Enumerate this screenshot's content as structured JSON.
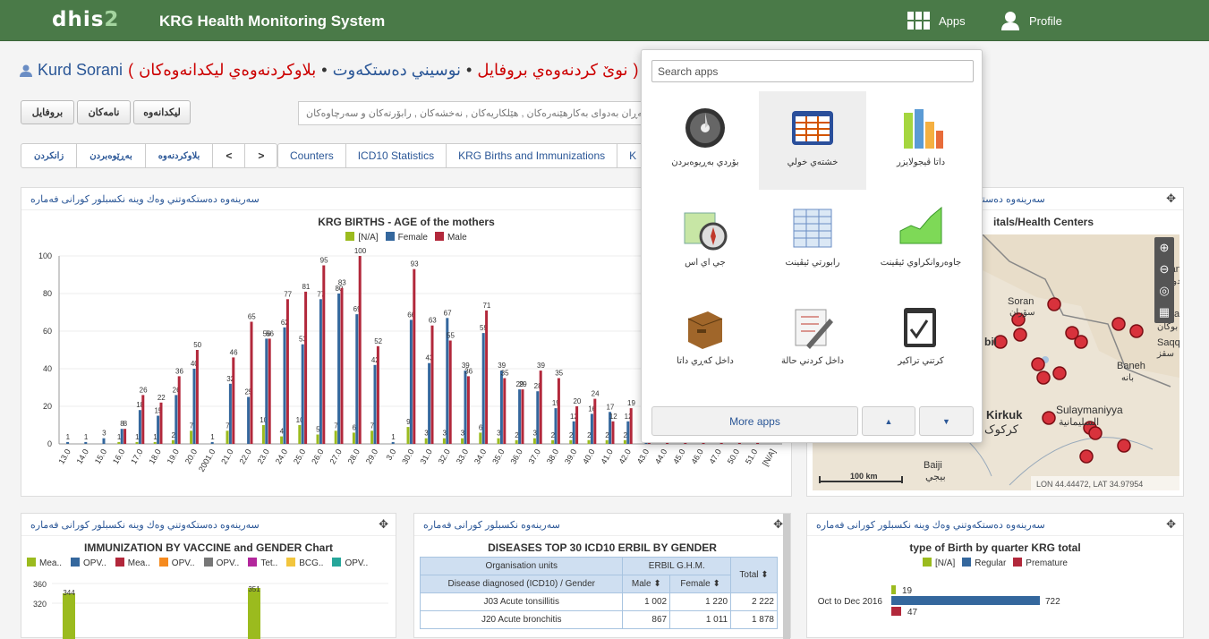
{
  "header": {
    "logo_main": "dhis",
    "logo_num": "2",
    "title": "KRG Health Monitoring System",
    "apps_label": "Apps",
    "profile_label": "Profile"
  },
  "user": {
    "name": "Kurd Sorani",
    "paren_open": "(",
    "new_interp": "نوێ كردنەوەي بروفايل",
    "sep1": "•",
    "write_post": "نوسيني دەستكەوت",
    "sep2": "•",
    "latest": "بلاوكردنەوەي ليكدانەوەكان",
    "paren_close": ")"
  },
  "buttons": {
    "interpretations": "ليكدانەوە",
    "messages": "نامەكان",
    "profile": "بروفايل"
  },
  "search_placeholder": "گەڕان بەدواى بەكارهێنەرەكان , هێلكاريەكان , نەخشەكان , رابۆرتەكان و سەرچاوەكان",
  "dash_tabs1": [
    "زانكردن",
    "بەڕێوەبردن",
    "بلاوكردنەوە",
    "<",
    ">"
  ],
  "dash_tabs2": [
    "Counters",
    "ICD10 Statistics",
    "KRG Births and Immunizations",
    "K"
  ],
  "panel_header": "سەرينەوە دەستكەوتني وەك وينە نكسبلور كورانى فەمارە",
  "panel_header2": "سەرينەوە دەستكەوتني وەك وينە نكسبلور كورانى فەمارە",
  "panel_header_tbl": "سەرينەوە نكسبلور كورانى فەمارە",
  "move_icon": "✥",
  "births": {
    "title": "KRG BIRTHS - AGE of the mothers",
    "legend": [
      "[N/A]",
      "Female",
      "Male"
    ]
  },
  "chart_data": [
    {
      "type": "bar",
      "title": "KRG BIRTHS - AGE of the mothers",
      "categories": [
        "13.0",
        "14.0",
        "15.0",
        "16.0",
        "17.0",
        "18.0",
        "19.0",
        "20.0",
        "2001.0",
        "21.0",
        "22.0",
        "23.0",
        "24.0",
        "25.0",
        "26.0",
        "27.0",
        "28.0",
        "29.0",
        "3.0",
        "30.0",
        "31.0",
        "32.0",
        "33.0",
        "34.0",
        "35.0",
        "36.0",
        "37.0",
        "38.0",
        "39.0",
        "40.0",
        "41.0",
        "42.0",
        "43.0",
        "44.0",
        "45.0",
        "46.0",
        "47.0",
        "50.0",
        "51.0",
        "[N/A]"
      ],
      "series": [
        {
          "name": "[N/A]",
          "color": "#9bbb1e",
          "values": [
            0,
            0,
            0,
            1,
            1,
            1,
            2,
            7,
            0,
            7,
            0,
            10,
            4,
            10,
            5,
            7,
            6,
            7,
            0,
            9,
            3,
            3,
            3,
            6,
            3,
            2,
            3,
            2,
            2,
            2,
            2,
            2,
            0,
            0,
            0,
            0,
            0,
            0,
            0,
            0
          ]
        },
        {
          "name": "Female",
          "color": "#34679d",
          "values": [
            1,
            1,
            3,
            8,
            18,
            15,
            26,
            40,
            1,
            32,
            25,
            56,
            62,
            53,
            77,
            80,
            69,
            42,
            1,
            66,
            43,
            67,
            39,
            59,
            39,
            29,
            28,
            19,
            12,
            16,
            17,
            12,
            3,
            0,
            0,
            0,
            0,
            0,
            0,
            0
          ]
        },
        {
          "name": "Male",
          "color": "#b2283b",
          "values": [
            0,
            0,
            0,
            8,
            26,
            22,
            36,
            50,
            0,
            46,
            65,
            56,
            77,
            81,
            95,
            83,
            100,
            52,
            0,
            93,
            63,
            55,
            36,
            71,
            35,
            29,
            39,
            35,
            20,
            24,
            12,
            19,
            6,
            2,
            2,
            1,
            1,
            1,
            1,
            0
          ]
        }
      ],
      "ylim": [
        0,
        100
      ],
      "yticks": [
        0,
        20,
        40,
        60,
        80,
        100
      ]
    },
    {
      "type": "bar",
      "title": "IMMUNIZATION BY VACCINE and GENDER Chart",
      "series": [
        {
          "name": "Mea..",
          "values": [
            344,
            351
          ]
        }
      ],
      "ylim": [
        300,
        360
      ],
      "yticks": [
        320,
        340,
        360
      ]
    },
    {
      "type": "bar",
      "title": "type of Birth by quarter KRG total",
      "categories": [
        "Oct to Dec 2016"
      ],
      "series": [
        {
          "name": "[N/A]",
          "values": [
            19
          ]
        },
        {
          "name": "Regular",
          "values": [
            722
          ]
        },
        {
          "name": "Premature",
          "values": [
            47
          ]
        }
      ]
    }
  ],
  "immun": {
    "title": "IMMUNIZATION BY VACCINE and GENDER Chart",
    "legend": [
      [
        "Mea..",
        "#9bbb1e"
      ],
      [
        "OPV..",
        "#34679d"
      ],
      [
        "Mea..",
        "#b2283b"
      ],
      [
        "OPV..",
        "#f58a1f"
      ],
      [
        "OPV..",
        "#777777"
      ],
      [
        "Tet..",
        "#b3279c"
      ],
      [
        "BCG..",
        "#f2c53d"
      ],
      [
        "OPV..",
        "#26a69a"
      ]
    ],
    "yticks": [
      "360",
      "320"
    ],
    "bars": [
      "344",
      "351"
    ]
  },
  "diseases": {
    "title": "DISEASES TOP 30 ICD10 ERBIL BY GENDER",
    "org_units": "Organisation units",
    "org": "ERBIL G.H.M.",
    "diag": "Disease diagnosed (ICD10) / Gender",
    "male": "Male ⬍",
    "female": "Female ⬍",
    "total": "Total ⬍",
    "rows": [
      [
        "J03 Acute tonsillitis",
        "1 002",
        "1 220",
        "2 222"
      ],
      [
        "J20 Acute bronchitis",
        "867",
        "1 011",
        "1 878"
      ]
    ]
  },
  "birthtype": {
    "title": "type of Birth by quarter KRG total",
    "legend": [
      [
        "[N/A]",
        "#9bbb1e"
      ],
      [
        "Regular",
        "#34679d"
      ],
      [
        "Premature",
        "#b2283b"
      ]
    ],
    "cat": "Oct to Dec 2016",
    "vals": [
      "19",
      "722",
      "47"
    ]
  },
  "map": {
    "title": "itals/Health Centers",
    "lon": "LON 44.44472, LAT 34.97954",
    "scale": "100 km",
    "places": [
      "Miandoab",
      "میاندوآب",
      "Soran",
      "سۆران",
      "Bukan",
      "بوکان",
      "Saqqez",
      "سقز",
      "Baneh",
      "بانه",
      "Sulaymaniyya",
      "السليمانية",
      "Kirkuk",
      "کرکوک",
      "Baiji",
      "بيجي",
      "bil"
    ]
  },
  "app_menu": {
    "search": "Search apps",
    "more": "More apps",
    "up": "▲",
    "down": "▼",
    "apps": [
      {
        "label": "داتا ڤيجولايزر",
        "icon": "bar-chart-icon"
      },
      {
        "label": "خشتەي خولي",
        "icon": "pivot-table-icon"
      },
      {
        "label": "بۆردي بەڕيوەبردن",
        "icon": "dashboard-icon"
      },
      {
        "label": "جاوەروانكراوي ئيڤينت",
        "icon": "event-visualizer-icon"
      },
      {
        "label": "رابورتي ئيڤينت",
        "icon": "event-report-icon"
      },
      {
        "label": "جي اي اس",
        "icon": "gis-map-icon"
      },
      {
        "label": "كرتني تراكير",
        "icon": "tracker-icon"
      },
      {
        "label": "داخل كردني حالة",
        "icon": "data-entry-icon"
      },
      {
        "label": "داخل كەڕي داتا",
        "icon": "import-export-icon"
      }
    ]
  }
}
